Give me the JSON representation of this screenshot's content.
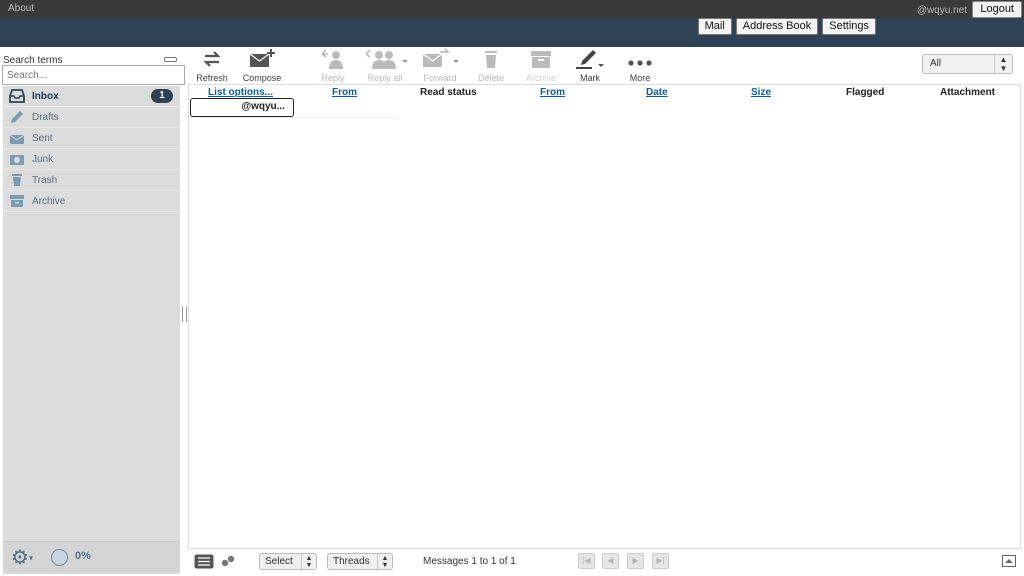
{
  "topline": {
    "about": "About",
    "username": "@wqyu.net",
    "logout": "Logout"
  },
  "tasks": {
    "mail": "Mail",
    "addressbook": "Address Book",
    "settings": "Settings"
  },
  "search": {
    "label": "Search terms",
    "placeholder": "Search..."
  },
  "folders": [
    {
      "label": "Inbox",
      "badge": "1",
      "icon": "inbox-icon",
      "active": true
    },
    {
      "label": "Drafts",
      "icon": "pencil-icon"
    },
    {
      "label": "Sent",
      "icon": "sent-icon"
    },
    {
      "label": "Junk",
      "icon": "junk-icon"
    },
    {
      "label": "Trash",
      "icon": "trash-icon"
    },
    {
      "label": "Archive",
      "icon": "archive-icon"
    }
  ],
  "quota": {
    "percent": "0%",
    "value": 0
  },
  "toolbar": {
    "refresh": "Refresh",
    "compose": "Compose",
    "reply": "Reply",
    "replyall": "Reply all",
    "forward": "Forward",
    "delete": "Delete",
    "archive": "Archive",
    "mark": "Mark",
    "more": "More"
  },
  "filter": {
    "selected": "All"
  },
  "list": {
    "headers": {
      "listoptions": "List options...",
      "from1": "From",
      "readstatus": "Read status",
      "from2": "From",
      "date": "Date",
      "size": "Size",
      "flagged": "Flagged",
      "attachment": "Attachment"
    },
    "rows": [
      {
        "from": "@wqyu..."
      }
    ]
  },
  "footer": {
    "select": "Select",
    "threads": "Threads",
    "count": "Messages 1 to 1 of 1"
  },
  "colors": {
    "header": "#2f4256",
    "topline": "#3a3a3a",
    "link": "#0b5d9e",
    "folderpane": "#dcdcdc"
  }
}
